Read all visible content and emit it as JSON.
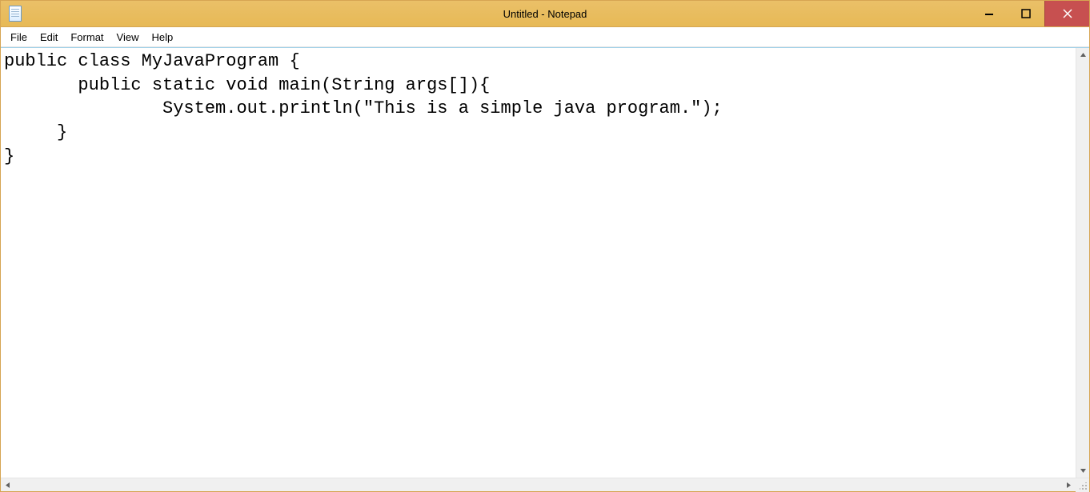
{
  "window": {
    "title": "Untitled - Notepad"
  },
  "menu": {
    "file": "File",
    "edit": "Edit",
    "format": "Format",
    "view": "View",
    "help": "Help"
  },
  "editor": {
    "content": "public class MyJavaProgram {\n       public static void main(String args[]){\n               System.out.println(\"This is a simple java program.\");\n     }\n}\n"
  }
}
